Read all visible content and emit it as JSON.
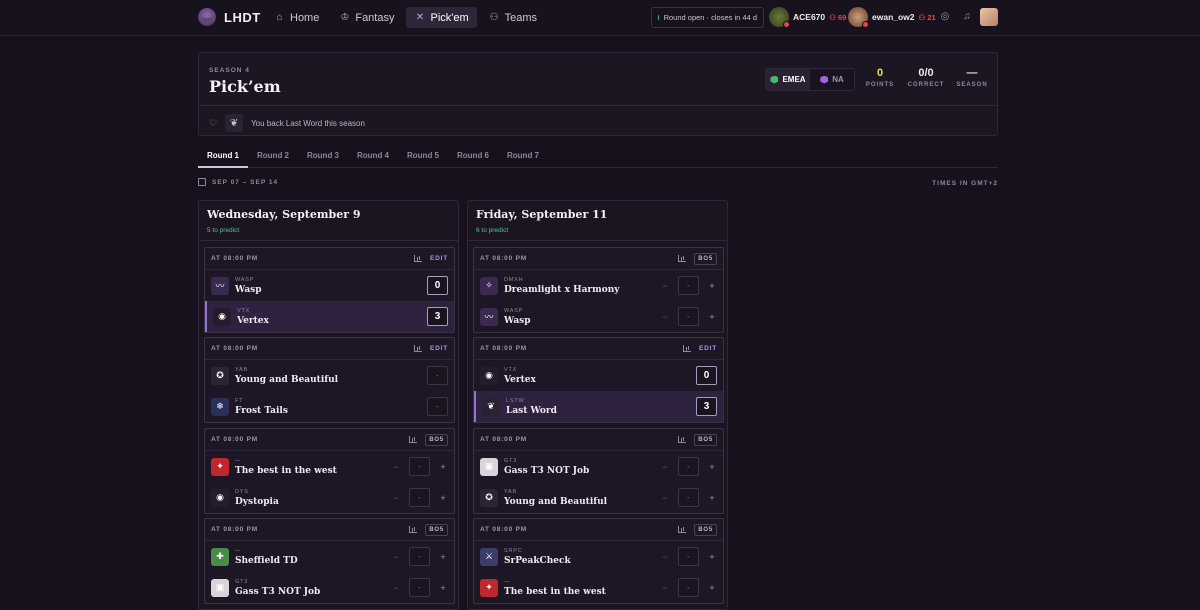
{
  "nav": {
    "brand": "LHDT",
    "links": [
      {
        "label": "Home",
        "icon": "home-icon"
      },
      {
        "label": "Fantasy",
        "icon": "crown-icon"
      },
      {
        "label": "Pick'em",
        "icon": "swords-icon",
        "active": true
      },
      {
        "label": "Teams",
        "icon": "users-icon"
      }
    ],
    "round_status": "Round open · closes in 44 d",
    "users": [
      {
        "name": "ACE670",
        "count": "69"
      },
      {
        "name": "ewan_ow2",
        "count": "21"
      }
    ]
  },
  "header": {
    "season": "SEASON 4",
    "title": "Pick’em",
    "regions": [
      {
        "label": "EMEA",
        "color": "#3fbf6a",
        "active": true
      },
      {
        "label": "NA",
        "color": "#a462e0",
        "active": false
      }
    ],
    "stats": [
      {
        "value": "0",
        "label": "POINTS",
        "color": "#e8e04a"
      },
      {
        "value": "0/0",
        "label": "CORRECT",
        "color": "#ffffff"
      },
      {
        "value": "—",
        "label": "SEASON",
        "color": "#ffffff"
      }
    ],
    "backing_text": "You back Last Word this season"
  },
  "rounds": [
    "Round 1",
    "Round 2",
    "Round 3",
    "Round 4",
    "Round 5",
    "Round 6",
    "Round 7"
  ],
  "date_range": "SEP 07 – SEP 14",
  "timezone": "TIMES IN GMT+2",
  "days": [
    {
      "title": "Wednesday, September 9",
      "sub": "5 to predict",
      "matches": [
        {
          "time": "AT 08:00 PM",
          "action": "EDIT",
          "teams": [
            {
              "abbr": "WASP",
              "name": "Wasp",
              "score": "0",
              "winner": false,
              "logo": "#3a2a52",
              "glyph": "〰"
            },
            {
              "abbr": "VTX",
              "name": "Vertex",
              "score": "3",
              "winner": true,
              "logo": "#241c2e",
              "glyph": "◉"
            }
          ]
        },
        {
          "time": "AT 08:00 PM",
          "action": "EDIT",
          "teams": [
            {
              "abbr": "YAB",
              "name": "Young and Beautiful",
              "score": "-",
              "winner": false,
              "logo": "#2c2434",
              "glyph": "✪"
            },
            {
              "abbr": "FT",
              "name": "Frost Tails",
              "score": "-",
              "winner": false,
              "logo": "#2a2f5a",
              "glyph": "❄"
            }
          ]
        },
        {
          "time": "AT 08:00 PM",
          "action": "BO5",
          "teams": [
            {
              "abbr": "—",
              "name": "The best in the west",
              "score": "-",
              "winner": false,
              "logo": "#c0262d",
              "glyph": "✦"
            },
            {
              "abbr": "DYS",
              "name": "Dystopia",
              "score": "-",
              "winner": false,
              "logo": "#241c2e",
              "glyph": "◉"
            }
          ]
        },
        {
          "time": "AT 08:00 PM",
          "action": "BO5",
          "teams": [
            {
              "abbr": "—",
              "name": "Sheffield TD",
              "score": "-",
              "winner": false,
              "logo": "#4a8a4a",
              "glyph": "✚"
            },
            {
              "abbr": "GT3",
              "name": "Gass T3 NOT Job",
              "score": "-",
              "winner": false,
              "logo": "#d8d4dc",
              "glyph": "▣"
            }
          ]
        }
      ]
    },
    {
      "title": "Friday, September 11",
      "sub": "6 to predict",
      "matches": [
        {
          "time": "AT 08:00 PM",
          "action": "BO5",
          "teams": [
            {
              "abbr": "DMXH",
              "name": "Dreamlight x Harmony",
              "score": "-",
              "winner": false,
              "logo": "#3a2a52",
              "glyph": "✧"
            },
            {
              "abbr": "WASP",
              "name": "Wasp",
              "score": "-",
              "winner": false,
              "logo": "#3a2a52",
              "glyph": "〰"
            }
          ]
        },
        {
          "time": "AT 08:00 PM",
          "action": "EDIT",
          "teams": [
            {
              "abbr": "VTX",
              "name": "Vertex",
              "score": "0",
              "winner": false,
              "logo": "#241c2e",
              "glyph": "◉"
            },
            {
              "abbr": "LSTW",
              "name": "Last Word",
              "score": "3",
              "winner": true,
              "logo": "#2a2233",
              "glyph": "❦"
            }
          ]
        },
        {
          "time": "AT 08:00 PM",
          "action": "BO5",
          "teams": [
            {
              "abbr": "GT3",
              "name": "Gass T3 NOT Job",
              "score": "-",
              "winner": false,
              "logo": "#d8d4dc",
              "glyph": "▣"
            },
            {
              "abbr": "YAB",
              "name": "Young and Beautiful",
              "score": "-",
              "winner": false,
              "logo": "#2c2434",
              "glyph": "✪"
            }
          ]
        },
        {
          "time": "AT 08:00 PM",
          "action": "BO5",
          "teams": [
            {
              "abbr": "SRPC",
              "name": "SrPeakCheck",
              "score": "-",
              "winner": false,
              "logo": "#3b3d6a",
              "glyph": "⚔"
            },
            {
              "abbr": "—",
              "name": "The best in the west",
              "score": "-",
              "winner": false,
              "logo": "#c0262d",
              "glyph": "✦"
            }
          ]
        }
      ]
    }
  ]
}
